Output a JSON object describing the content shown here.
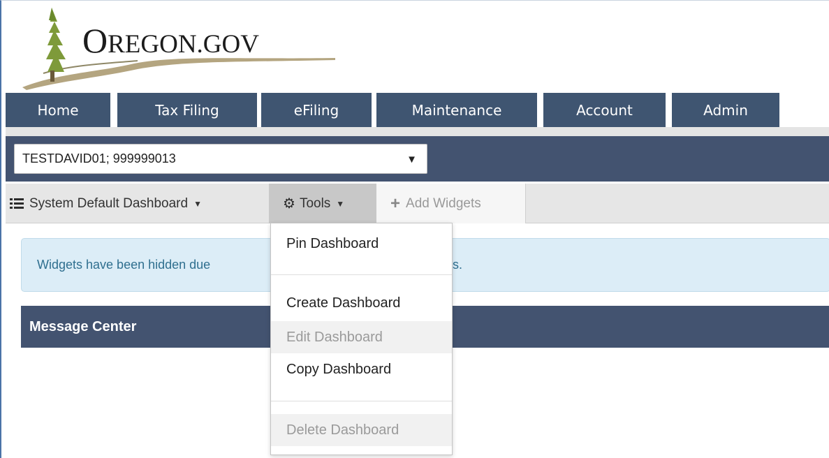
{
  "logo": {
    "first_letter": "O",
    "rest": "REGON.GOV"
  },
  "nav": {
    "tabs": [
      {
        "label": "Home"
      },
      {
        "label": "Tax Filing"
      },
      {
        "label": "eFiling"
      },
      {
        "label": "Maintenance"
      },
      {
        "label": "Account"
      },
      {
        "label": "Admin"
      }
    ]
  },
  "account_select": {
    "value": "TESTDAVID01; 999999013"
  },
  "toolbar": {
    "dashboard_label": "System Default Dashboard",
    "tools_label": "Tools",
    "add_widgets_label": "Add Widgets"
  },
  "alert": {
    "text_left": "Widgets have been hidden due",
    "text_right": "s."
  },
  "message_center": {
    "title": "Message Center"
  },
  "tools_menu": {
    "items": [
      {
        "label": "Pin Dashboard",
        "enabled": true
      },
      {
        "label": "Create Dashboard",
        "enabled": true
      },
      {
        "label": "Edit Dashboard",
        "enabled": false
      },
      {
        "label": "Copy Dashboard",
        "enabled": true
      },
      {
        "label": "Delete Dashboard",
        "enabled": false
      }
    ]
  },
  "colors": {
    "nav": "#3f5571",
    "band": "#435370",
    "alert_bg": "#dcedf7",
    "alert_text": "#2f6f8f"
  }
}
